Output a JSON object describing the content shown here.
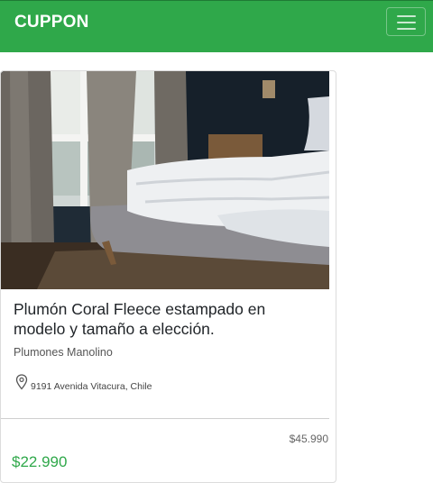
{
  "navbar": {
    "brand": "CUPPON",
    "accent_color": "#2fa84a",
    "menu_icon": "hamburger-menu-icon"
  },
  "deal": {
    "image_description_icon": "bedroom-photo",
    "title": "Plumón Coral Fleece estampado en modelo y tamaño a elección.",
    "merchant": "Plumones Manolino",
    "location_icon": "map-pin-icon",
    "address": "9191 Avenida Vitacura, Chile",
    "original_price": "$45.990",
    "price": "$22.990"
  }
}
